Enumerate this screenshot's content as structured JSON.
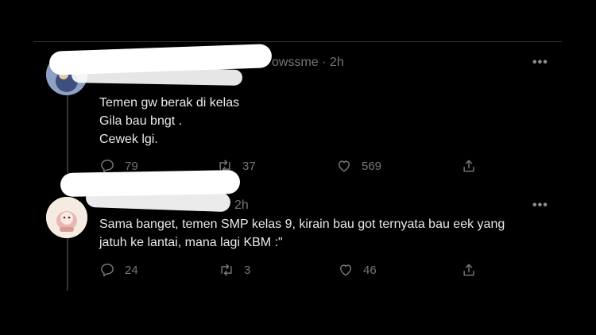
{
  "tweets": [
    {
      "handle_partial": "owssme",
      "sep": "·",
      "time": "2h",
      "text": "Temen gw berak di kelas\nGila bau bngt .\nCewek lgi.",
      "replies": "79",
      "retweets": "37",
      "likes": "569",
      "icons": [
        "reply-icon",
        "retweet-icon",
        "like-icon",
        "share-icon"
      ]
    },
    {
      "time": "2h",
      "text": "Sama banget, temen SMP kelas 9, kirain bau got ternyata bau eek yang\njatuh ke lantai, mana lagi KBM :\"",
      "replies": "24",
      "retweets": "3",
      "likes": "46",
      "icons": [
        "reply-icon",
        "retweet-icon",
        "like-icon",
        "share-icon"
      ]
    }
  ],
  "more_label": "•••",
  "colors": {
    "background": "#000000",
    "text": "#e7e9ea",
    "muted": "#71767b",
    "divider": "#2f3336"
  }
}
